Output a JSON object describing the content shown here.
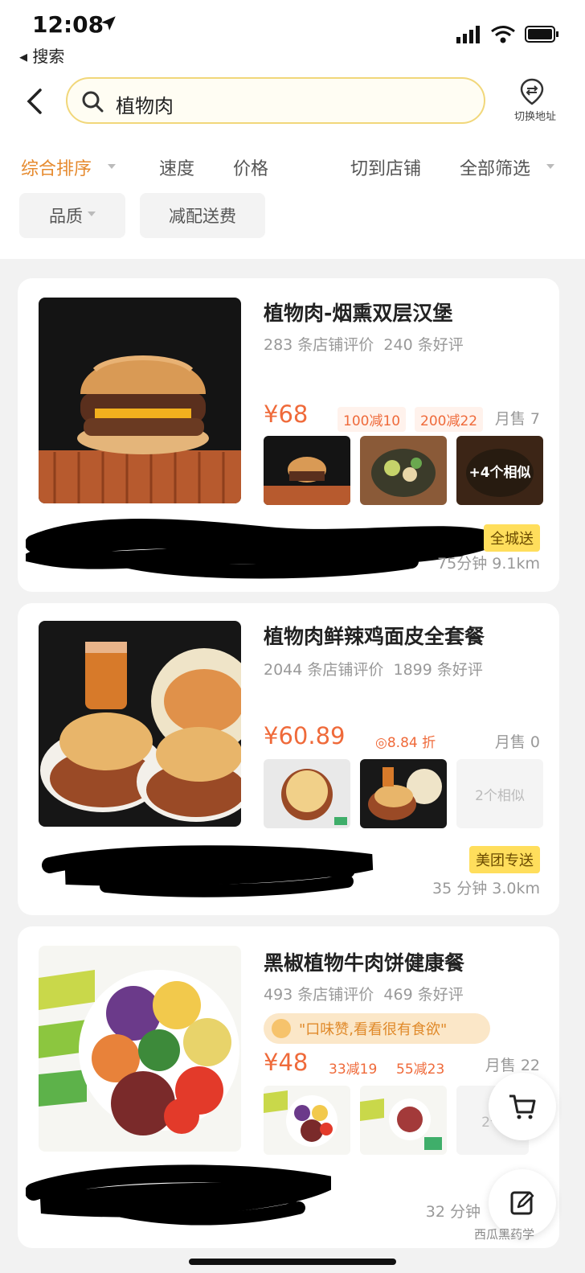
{
  "status": {
    "time": "12:08",
    "back_app": "◂ 搜索"
  },
  "search": {
    "query": "植物肉",
    "address_label": "切换地址"
  },
  "sort_tabs": [
    {
      "label": "综合排序"
    },
    {
      "label": "速度"
    },
    {
      "label": "价格"
    },
    {
      "label": "切到店铺"
    },
    {
      "label": "全部筛选"
    }
  ],
  "filter_chips": [
    {
      "label": "品质"
    },
    {
      "label": "减配送费"
    }
  ],
  "items": [
    {
      "title": "植物肉-烟熏双层汉堡",
      "reviews": "283 条店铺评价",
      "good_reviews": "240 条好评",
      "price": "¥68",
      "coupons": [
        "100减10",
        "200减22"
      ],
      "monthly_sales": "月售 7",
      "more_label": "+4个相似",
      "tag": "全城送",
      "eta": "75分钟  9.1km"
    },
    {
      "title": "植物肉鲜辣鸡面皮全套餐",
      "reviews": "2044 条店铺评价",
      "good_reviews": "1899 条好评",
      "price": "¥60.89",
      "discount": "8.84 折",
      "monthly_sales": "月售 0",
      "more_label": "2个相似",
      "tag": "美团专送",
      "eta": "35 分钟  3.0km"
    },
    {
      "title": "黑椒植物牛肉饼健康餐",
      "reviews": "493 条店铺评价",
      "good_reviews": "469 条好评",
      "promo": "\"口味赞,看看很有食欲\"",
      "price": "¥48",
      "coupons": [
        "33减19",
        "55减23"
      ],
      "monthly_sales": "月售 22",
      "more_label": "2个",
      "eta": "32 分钟"
    }
  ],
  "watermark": "西瓜黑药学",
  "colors": {
    "accent": "#e68a2e",
    "price": "#ef6a3a",
    "tag_yellow": "#ffde5c"
  }
}
